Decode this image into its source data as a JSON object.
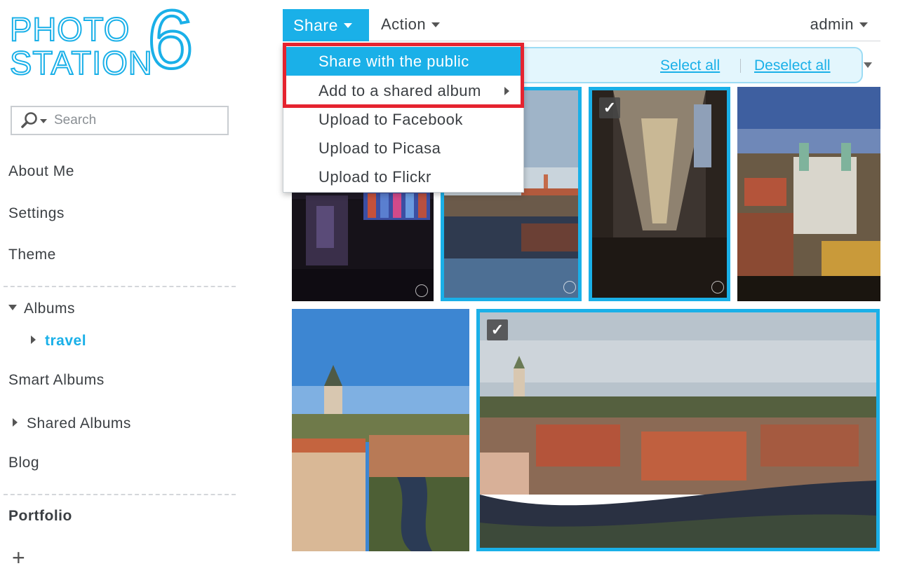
{
  "logo": {
    "line1": "PHOTO",
    "line2": "STATION",
    "version": "6"
  },
  "search": {
    "placeholder": "Search"
  },
  "sidebar": {
    "about_me": "About Me",
    "settings": "Settings",
    "theme": "Theme",
    "albums": "Albums",
    "album_travel": "travel",
    "smart_albums": "Smart Albums",
    "shared_albums": "Shared Albums",
    "blog": "Blog",
    "portfolio": "Portfolio",
    "add": "+"
  },
  "toolbar": {
    "share": "Share",
    "action": "Action",
    "user": "admin"
  },
  "selection": {
    "select_all": "Select all",
    "deselect_all": "Deselect all"
  },
  "share_menu": {
    "items": [
      "Share with the public",
      "Add to a shared album",
      "Upload to Facebook",
      "Upload to Picasa",
      "Upload to Flickr"
    ]
  },
  "colors": {
    "accent": "#1ab0e8",
    "highlight_box": "#e5232f"
  },
  "icons": {
    "check": "✓"
  }
}
